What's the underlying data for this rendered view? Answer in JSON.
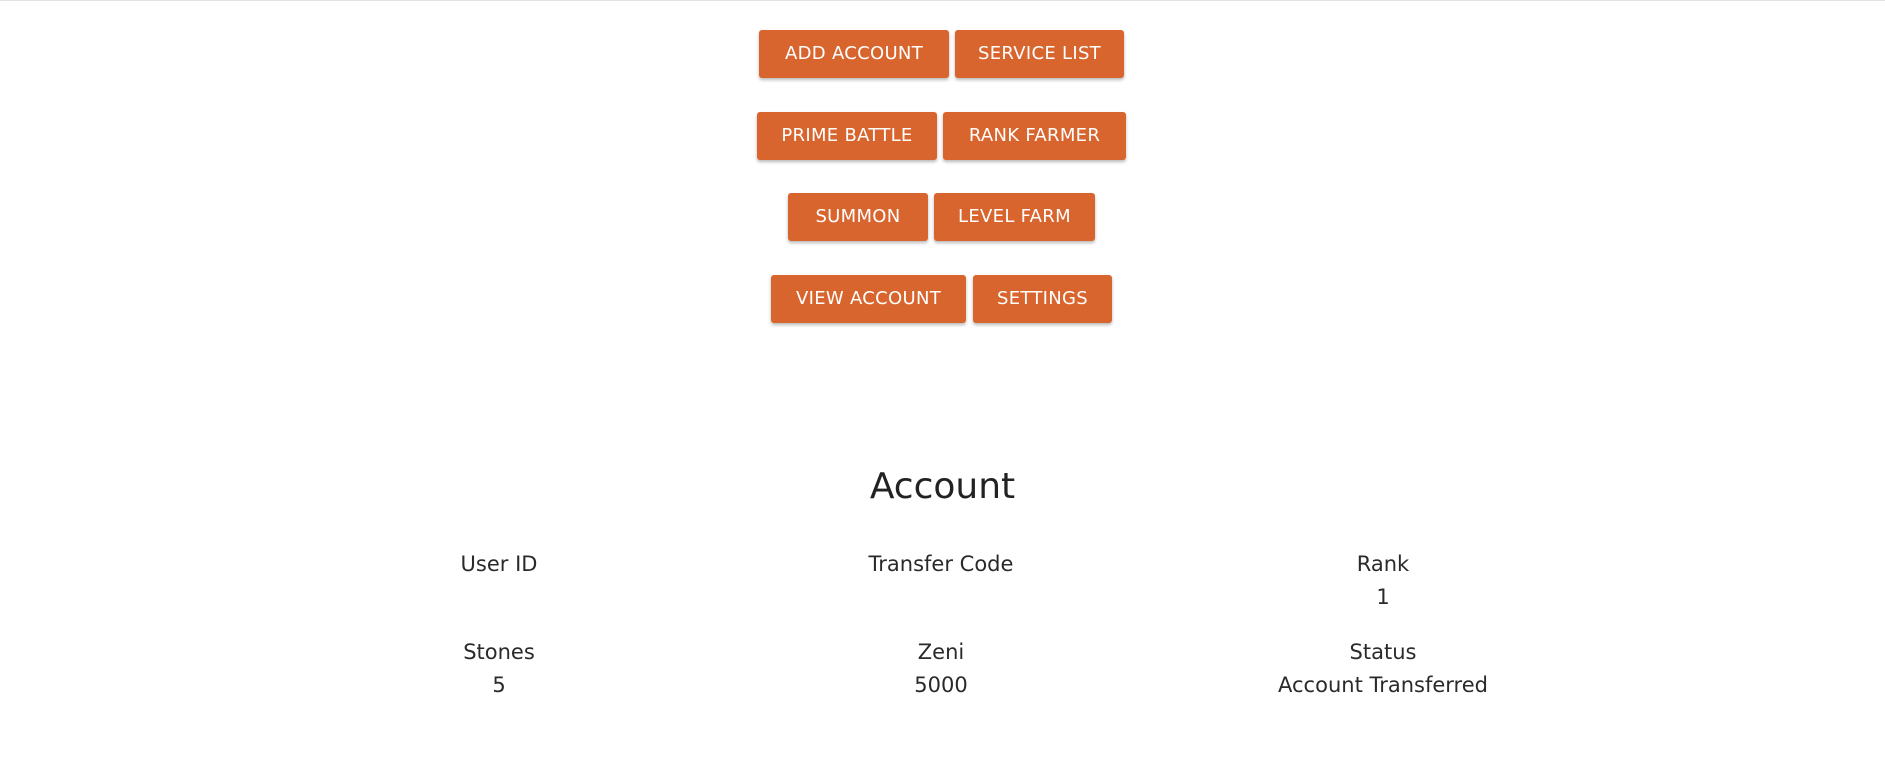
{
  "nav": {
    "add_account": "ADD ACCOUNT",
    "service_list": "SERVICE LIST",
    "prime_battle": "PRIME BATTLE",
    "rank_farmer": "RANK FARMER",
    "summon": "SUMMON",
    "level_farm": "LEVEL FARM",
    "view_account": "VIEW ACCOUNT",
    "settings": "SETTINGS"
  },
  "colors": {
    "button_bg": "#d9652e",
    "button_text": "#ffffff"
  },
  "account": {
    "title": "Account",
    "fields": {
      "user_id": {
        "label": "User ID",
        "value": ""
      },
      "transfer_code": {
        "label": "Transfer Code",
        "value": ""
      },
      "rank": {
        "label": "Rank",
        "value": "1"
      },
      "stones": {
        "label": "Stones",
        "value": "5"
      },
      "zeni": {
        "label": "Zeni",
        "value": "5000"
      },
      "status": {
        "label": "Status",
        "value": "Account Transferred"
      }
    }
  }
}
